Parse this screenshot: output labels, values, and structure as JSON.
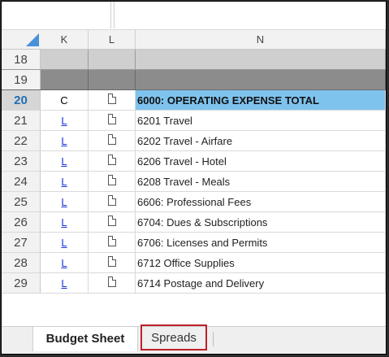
{
  "columns": {
    "k": "K",
    "l": "L",
    "n": "N"
  },
  "rows": [
    {
      "num": "18",
      "k": "",
      "l": "",
      "n": "",
      "style": "gray"
    },
    {
      "num": "19",
      "k": "",
      "l": "",
      "n": "",
      "style": "dark"
    },
    {
      "num": "20",
      "k": "C",
      "l": "doc-icon",
      "n": "6000: OPERATING EXPENSE TOTAL",
      "style": "total"
    },
    {
      "num": "21",
      "k": "L",
      "l": "doc-icon",
      "n": "6201 Travel",
      "style": "normal"
    },
    {
      "num": "22",
      "k": "L",
      "l": "doc-icon",
      "n": "6202 Travel - Airfare",
      "style": "normal"
    },
    {
      "num": "23",
      "k": "L",
      "l": "doc-icon",
      "n": "6206 Travel - Hotel",
      "style": "normal"
    },
    {
      "num": "24",
      "k": "L",
      "l": "doc-icon",
      "n": "6208 Travel - Meals",
      "style": "normal"
    },
    {
      "num": "25",
      "k": "L",
      "l": "doc-icon",
      "n": "6606: Professional Fees",
      "style": "normal"
    },
    {
      "num": "26",
      "k": "L",
      "l": "doc-icon",
      "n": "6704: Dues & Subscriptions",
      "style": "normal"
    },
    {
      "num": "27",
      "k": "L",
      "l": "doc-icon",
      "n": "6706: Licenses and Permits",
      "style": "normal"
    },
    {
      "num": "28",
      "k": "L",
      "l": "doc-icon",
      "n": "6712 Office Supplies",
      "style": "normal"
    },
    {
      "num": "29",
      "k": "L",
      "l": "doc-icon",
      "n": "6714 Postage and Delivery",
      "style": "normal"
    }
  ],
  "tabs": {
    "active": "Budget Sheet",
    "other": "Spreads"
  },
  "colors": {
    "total_row": "#7ec3ee",
    "link": "#1a35d8",
    "highlight_border": "#c0202a"
  }
}
